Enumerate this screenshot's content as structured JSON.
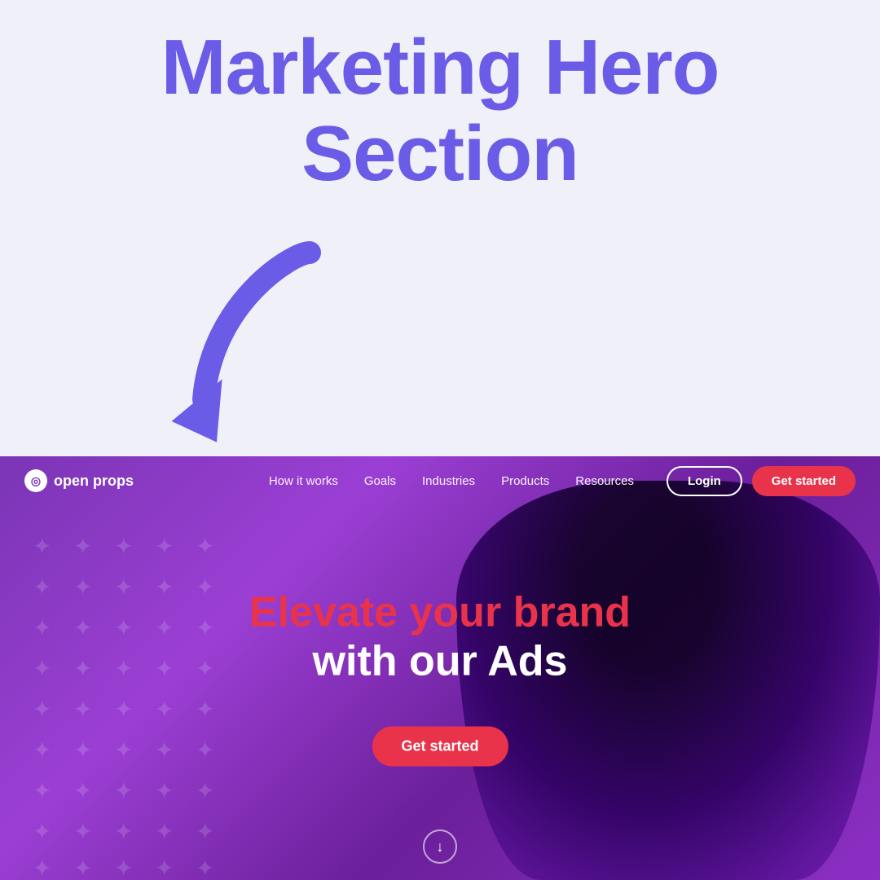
{
  "annotation": {
    "title_line1": "Marketing Hero",
    "title_line2": "Section",
    "title_color": "#6b5ce7"
  },
  "navbar": {
    "logo_text": "open props",
    "logo_icon": "◎",
    "links": [
      {
        "label": "How it works",
        "id": "how-it-works"
      },
      {
        "label": "Goals",
        "id": "goals"
      },
      {
        "label": "Industries",
        "id": "industries"
      },
      {
        "label": "Products",
        "id": "products"
      },
      {
        "label": "Resources",
        "id": "resources"
      }
    ],
    "login_label": "Login",
    "get_started_label": "Get started"
  },
  "hero": {
    "headline_line1": "Elevate your brand",
    "headline_line2": "with our Ads",
    "cta_label": "Get started",
    "scroll_icon": "↓"
  },
  "colors": {
    "accent_purple": "#6b5ce7",
    "hero_bg_start": "#7b35b5",
    "hero_bg_end": "#9b3fd4",
    "cta_red": "#e8334a",
    "white": "#ffffff"
  }
}
